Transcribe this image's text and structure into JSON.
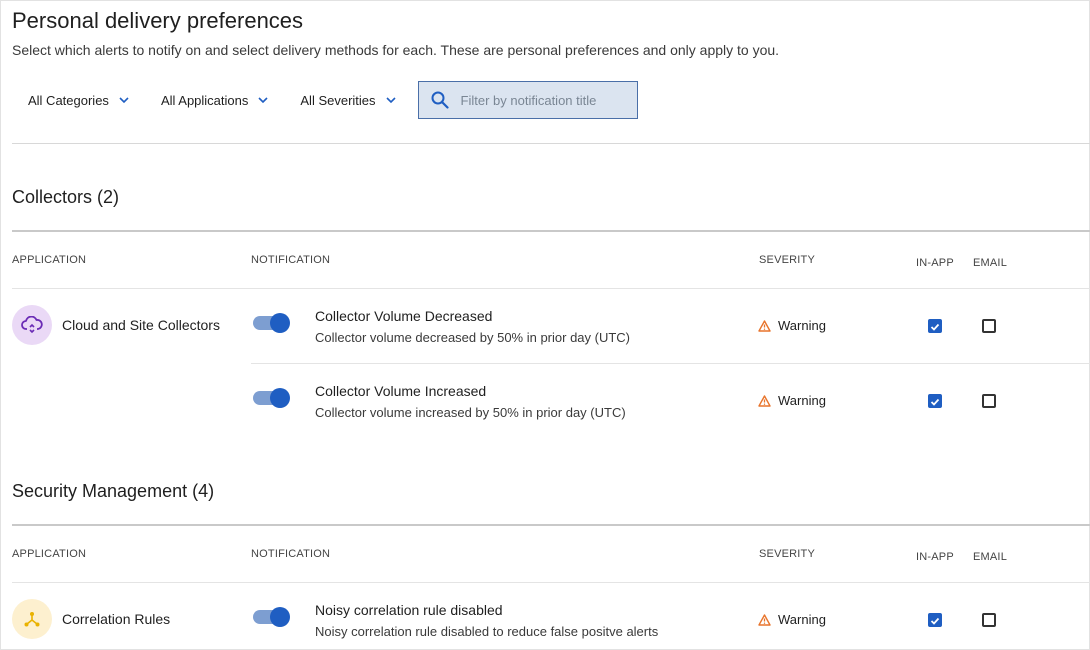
{
  "header": {
    "title": "Personal delivery preferences",
    "subtitle": "Select which alerts to notify on and select delivery methods for each. These are personal preferences and only apply to you."
  },
  "filters": {
    "categories": "All Categories",
    "applications": "All Applications",
    "severities": "All Severities",
    "search_placeholder": "Filter by notification title"
  },
  "columns": {
    "application": "APPLICATION",
    "notification": "NOTIFICATION",
    "severity": "SEVERITY",
    "in_app": "IN-APP",
    "email": "EMAIL"
  },
  "sections": [
    {
      "title": "Collectors (2)",
      "app": {
        "name": "Cloud and Site Collectors",
        "icon": "cloud-sync-icon",
        "icon_bg": "#ead9f6",
        "icon_color": "#6a2bb5"
      },
      "rows": [
        {
          "title": "Collector Volume Decreased",
          "description": "Collector volume decreased by 50% in prior day (UTC)",
          "enabled": true,
          "severity": "Warning",
          "in_app": true,
          "email": false
        },
        {
          "title": "Collector Volume Increased",
          "description": "Collector volume increased by 50% in prior day (UTC)",
          "enabled": true,
          "severity": "Warning",
          "in_app": true,
          "email": false
        }
      ]
    },
    {
      "title": "Security Management (4)",
      "app": {
        "name": "Correlation Rules",
        "icon": "correlation-icon",
        "icon_bg": "#fdf0cf",
        "icon_color": "#e9b200"
      },
      "rows": [
        {
          "title": "Noisy correlation rule disabled",
          "description": "Noisy correlation rule disabled to reduce false positve alerts",
          "enabled": true,
          "severity": "Warning",
          "in_app": true,
          "email": false
        }
      ]
    }
  ],
  "colors": {
    "accent": "#1f5ec2",
    "warning": "#e8742b",
    "toggle_track": "#7d9ed1"
  }
}
